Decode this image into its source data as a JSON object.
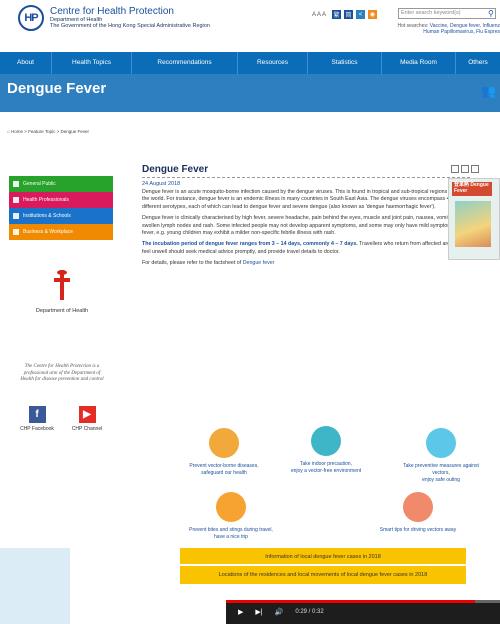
{
  "header": {
    "logo_text": "HP",
    "org_name": "Centre for Health Protection",
    "dept": "Department of Health",
    "gov": "The Government of the Hong Kong Special Administrative Region",
    "text_size": "A A A",
    "search_placeholder": "Enter search keyword(s)",
    "hot_label": "Hot searches:",
    "hot_terms_1": "Vaccine,  Dengue fever,  Influenz",
    "hot_terms_2": "Human Papillomavirus,  Flu Expres"
  },
  "nav": {
    "items": [
      "About",
      "Health Topics",
      "Recommendations",
      "Resources",
      "Statistics",
      "Media Room",
      "Others"
    ]
  },
  "banner": {
    "title": "Dengue Fever"
  },
  "breadcrumb": {
    "home": "Home",
    "sep": ">",
    "c1": "Feature Topic",
    "c2": "Dengue Fever"
  },
  "sidebar": {
    "items": [
      {
        "label": "General Public",
        "color": "#27a22b"
      },
      {
        "label": "Health Professionals",
        "color": "#d91a5c"
      },
      {
        "label": "Institutions & Schools",
        "color": "#1a73c9"
      },
      {
        "label": "Business & Workplace",
        "color": "#f08a00"
      }
    ],
    "doh": "Department of Health",
    "motto": "The Centre for Health Protection is a professional arm of the Department of Health for disease prevention and control",
    "facebook": "CHP Facebook",
    "channel": "CHP Channel"
  },
  "main": {
    "title": "Dengue Fever",
    "date": "24 August 2018",
    "p1": "Dengue fever is an acute mosquito-borne infection caused by the dengue viruses. This is found in tropical and sub-tropical regions around the world. For instance, dengue fever is an endemic illness in many countries in South East Asia. The dengue viruses encompass 4 different serotypes, each of which can lead to dengue fever and severe dengue (also known as 'dengue haemorrhagic fever').",
    "p2": "Dengue fever is clinically characterised by high fever, severe headache, pain behind the eyes, muscle and joint pain, nausea, vomiting, swollen lymph nodes and rash. Some infected people may not develop apparent symptoms, and some may only have mild symptoms like fever, e.g. young children may exhibit a milder non-specific febrile illness with rash.",
    "p3_bold": "The incubation period of dengue fever ranges from 3 – 14 days, commonly 4 – 7 days.",
    "p3_rest": " Travellers who return from affected areas and feel unwell should seek medical advice promptly, and provide travel details to doctor.",
    "p4_pre": "For details, please refer to the factsheet of ",
    "p4_link": "Dengue fever",
    "poster_title": "登革熱 Dengue Fever"
  },
  "tiles": [
    {
      "l1": "Prevent vector-borne diseases,",
      "l2": "safeguard our health",
      "color": "#f2a93b"
    },
    {
      "l1": "Take indoor precaution,",
      "l2": "enjoy a vector-free environment",
      "color": "#3fb6c8"
    },
    {
      "l1": "Take preventive measures against",
      "l2": "vectors,",
      "l3": "enjoy safe outing",
      "color": "#5cc7e8"
    },
    {
      "l1": "Prevent bites and stings during travel,",
      "l2": "have a nice trip",
      "color": "#f6a332"
    },
    {
      "l1": "Smart tips for driving vectors away",
      "l2": "",
      "color": "#f08a6a"
    }
  ],
  "links": {
    "b1": "Information of local dengue fever cases in 2018",
    "b2": "Locations of the residences and local movements of local dengue fever cases in 2018"
  },
  "video": {
    "time": "0:29 / 0:32",
    "progress": 0.91
  }
}
